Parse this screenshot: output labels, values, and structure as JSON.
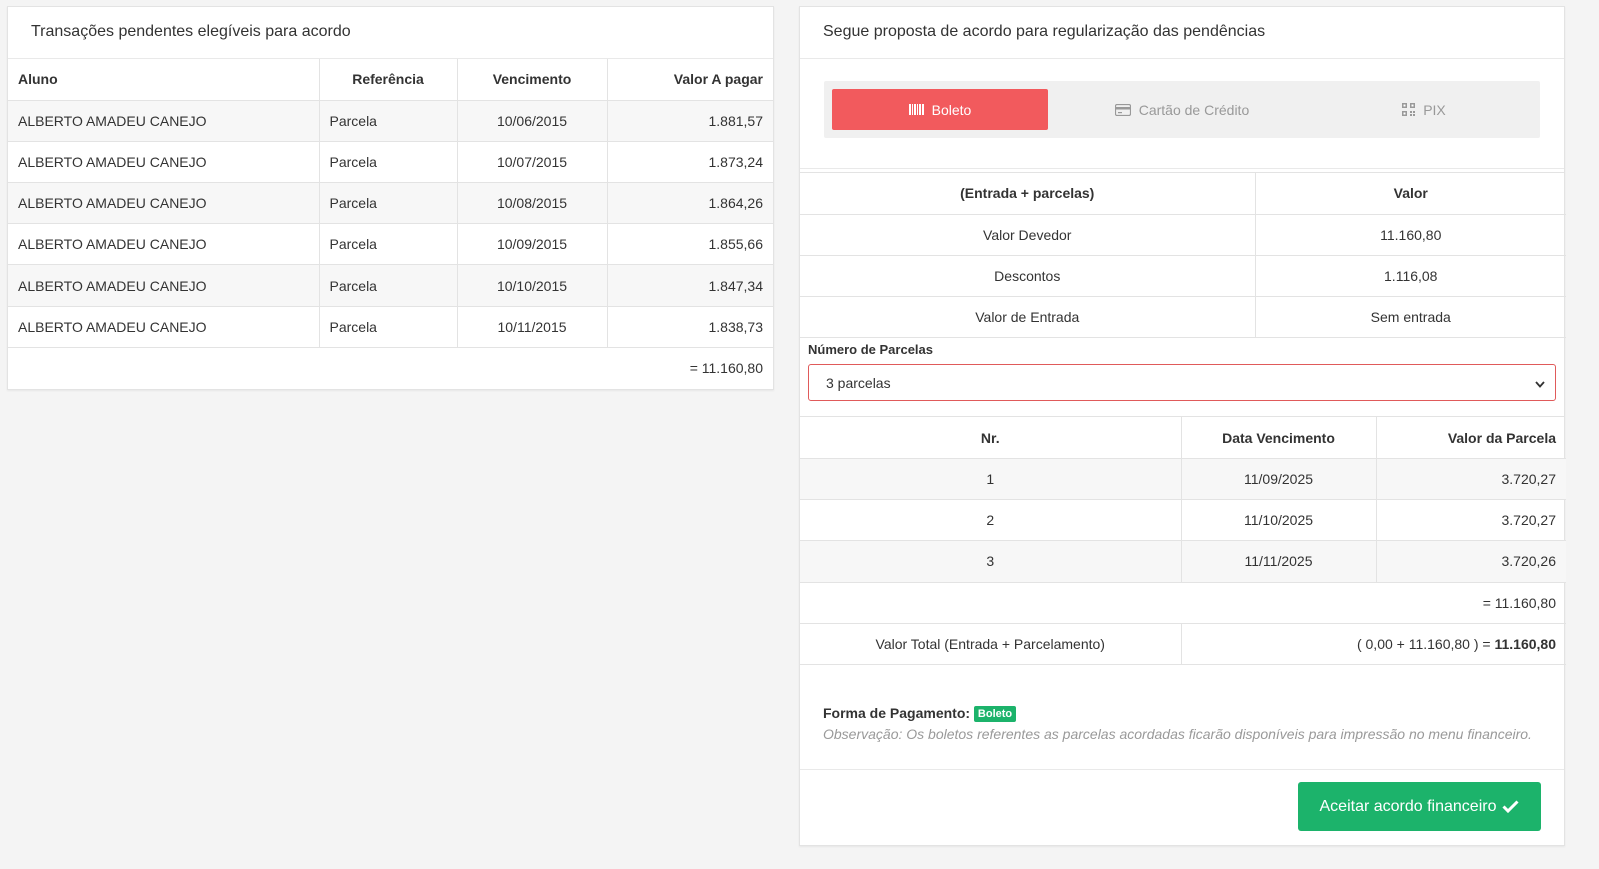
{
  "left_panel": {
    "title": "Transações pendentes elegíveis para acordo",
    "headers": [
      "Aluno",
      "Referência",
      "Vencimento",
      "Valor A pagar"
    ],
    "rows": [
      [
        "ALBERTO AMADEU CANEJO",
        "Parcela",
        "10/06/2015",
        "1.881,57"
      ],
      [
        "ALBERTO AMADEU CANEJO",
        "Parcela",
        "10/07/2015",
        "1.873,24"
      ],
      [
        "ALBERTO AMADEU CANEJO",
        "Parcela",
        "10/08/2015",
        "1.864,26"
      ],
      [
        "ALBERTO AMADEU CANEJO",
        "Parcela",
        "10/09/2015",
        "1.855,66"
      ],
      [
        "ALBERTO AMADEU CANEJO",
        "Parcela",
        "10/10/2015",
        "1.847,34"
      ],
      [
        "ALBERTO AMADEU CANEJO",
        "Parcela",
        "10/11/2015",
        "1.838,73"
      ]
    ],
    "total": "= 11.160,80"
  },
  "right_panel": {
    "title": "Segue proposta de acordo para regularização das pendências",
    "tabs": [
      {
        "label": "Boleto",
        "icon": "barcode-icon",
        "active": true
      },
      {
        "label": "Cartão de Crédito",
        "icon": "credit-card-icon",
        "active": false
      },
      {
        "label": "PIX",
        "icon": "qr-code-icon",
        "active": false
      }
    ],
    "summary": {
      "headers": [
        "(Entrada + parcelas)",
        "Valor"
      ],
      "rows": [
        [
          "Valor Devedor",
          "11.160,80"
        ],
        [
          "Descontos",
          "1.116,08"
        ],
        [
          "Valor de Entrada",
          "Sem entrada"
        ]
      ]
    },
    "parcelas_label": "Número de Parcelas",
    "parcelas_value": "3 parcelas",
    "installments": {
      "headers": [
        "Nr.",
        "Data Vencimento",
        "Valor da Parcela"
      ],
      "rows": [
        [
          "1",
          "11/09/2025",
          "3.720,27"
        ],
        [
          "2",
          "11/10/2025",
          "3.720,27"
        ],
        [
          "3",
          "11/11/2025",
          "3.720,26"
        ]
      ],
      "subtotal": "= 11.160,80",
      "total_label": "Valor Total (Entrada + Parcelamento)",
      "total_formula": "( 0,00 + 11.160,80 ) = ",
      "total_value": "11.160,80"
    },
    "payment_method_label": "Forma de Pagamento:",
    "payment_method_badge": "Boleto",
    "observation": "Observação: Os boletos referentes as parcelas acordadas ficarão disponíveis para impressão no menu financeiro.",
    "accept_button": "Aceitar acordo financeiro"
  },
  "colors": {
    "active_tab": "#f25a5d",
    "accept_button": "#1cb36b",
    "badge": "#1cb36b",
    "select_border": "#e05a5a"
  }
}
